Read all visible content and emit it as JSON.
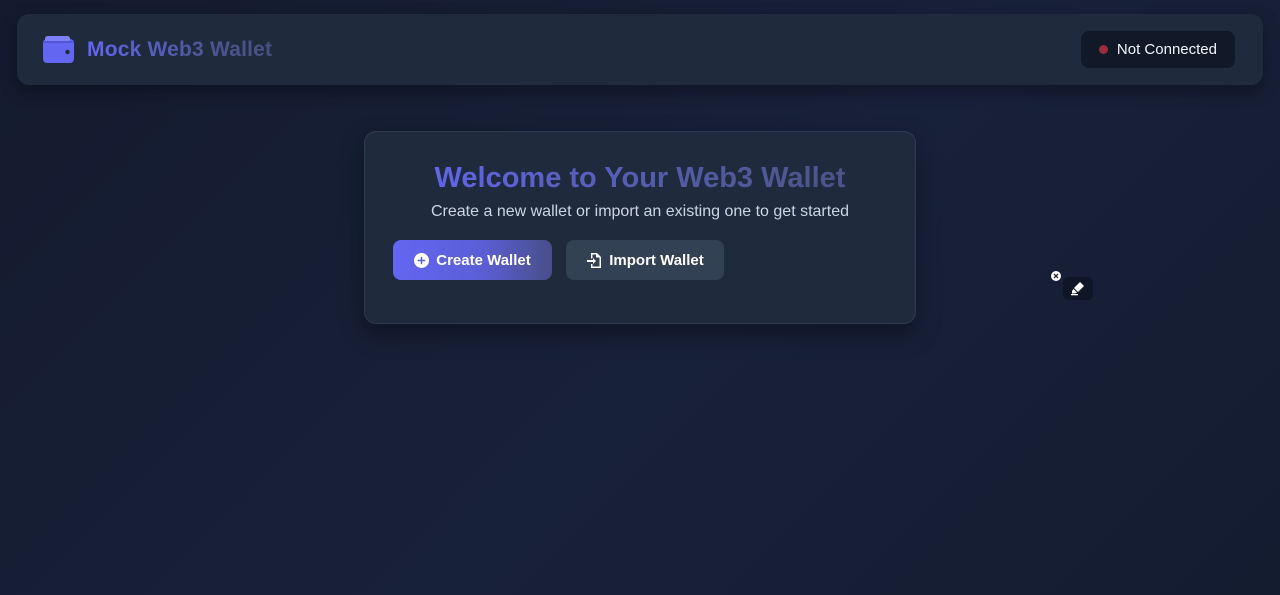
{
  "app": {
    "title": "Mock Web3 Wallet"
  },
  "header": {
    "icon": "wallet-icon",
    "status_label": "Not Connected",
    "status_color": "#9b2c3a"
  },
  "welcome_card": {
    "title": "Welcome to Your Web3 Wallet",
    "subtitle": "Create a new wallet or import an existing one to get started",
    "create_label": "Create Wallet",
    "create_icon": "plus-circle-icon",
    "import_label": "Import Wallet",
    "import_icon": "file-import-icon"
  },
  "floating_tool": {
    "close_icon": "close-icon",
    "tool_icon": "pen-icon"
  },
  "colors": {
    "accent": "#6366f1",
    "background": "#161e33",
    "panel": "#1f2a3d",
    "secondary_button": "#334155"
  }
}
